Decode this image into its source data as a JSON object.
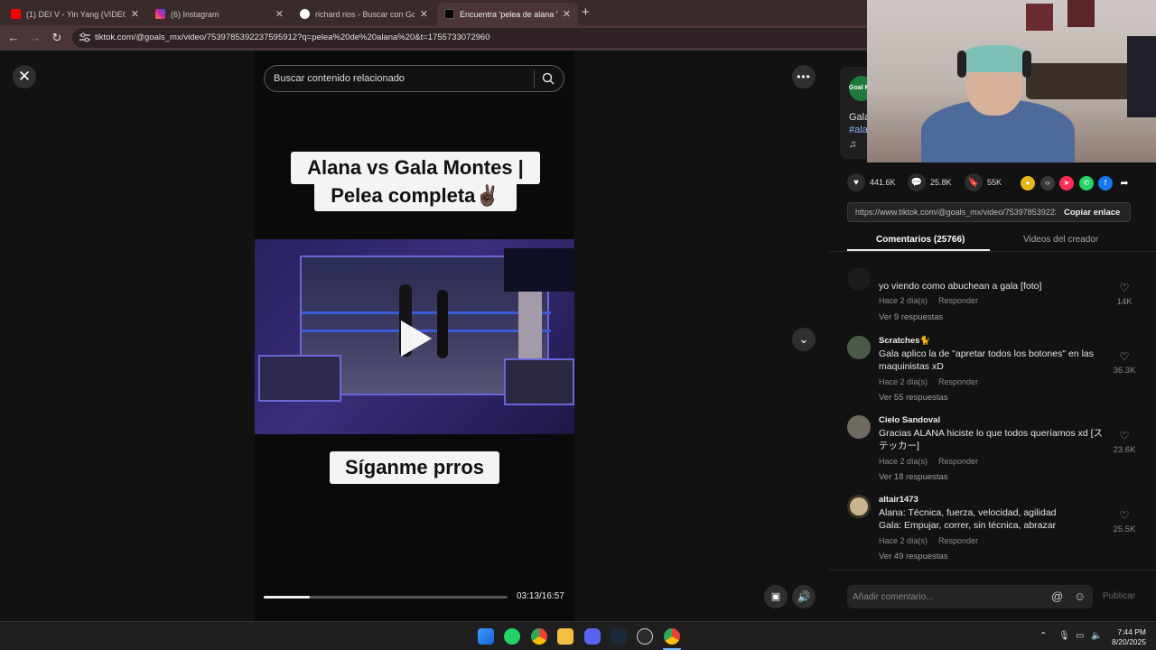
{
  "browser": {
    "tabs": [
      {
        "title": "(1) DEI V - Yin Yang (VIDEO OFICIAL)",
        "favicon_color": "#ff0000",
        "active": false
      },
      {
        "title": "(6) Instagram",
        "favicon_color": "#d6249f",
        "active": false
      },
      {
        "title": "richard rios - Buscar con Google",
        "favicon_color": "#ffffff",
        "active": false
      },
      {
        "title": "Encuentra 'pelea de alana ' en TikTok",
        "favicon_color": "#000000",
        "active": true
      }
    ],
    "new_tab": "+",
    "close_glyph": "✕",
    "url": "tiktok.com/@goals_mx/video/7539785392237595912?q=pelea%20de%20alana%20&t=1755733072960"
  },
  "video": {
    "search_placeholder": "Buscar contenido relacionado",
    "caption_line1": "Alana vs Gala Montes |",
    "caption_line2": "Pelea completa✌🏿",
    "caption_bottom": "Síganme prros",
    "time": "03:13/16:57",
    "progress": 0.19
  },
  "panel": {
    "creator_avatar_text": "Goal MX",
    "desc_snippet": "Gala",
    "hashtag_snippet": "#ala",
    "stats": {
      "likes": "441.6K",
      "comments": "25.8K",
      "saves": "55K"
    },
    "link": "https://www.tiktok.com/@goals_mx/video/7539785392237595912",
    "copy_label": "Copiar enlace",
    "tabs": {
      "comments": "Comentarios (25766)",
      "creator_videos": "Videos del creador"
    },
    "comments": [
      {
        "user": "",
        "text": "yo viendo como abuchean a gala [foto]",
        "time": "Hace 2 día(s)",
        "reply": "Responder",
        "replies": "Ver 9 respuestas",
        "likes": "14K"
      },
      {
        "user": "Scratches🐈",
        "text": "Gala aplico la de \"apretar todos los botones\" en las maquinistas xD",
        "time": "Hace 2 día(s)",
        "reply": "Responder",
        "replies": "Ver 55 respuestas",
        "likes": "36.3K"
      },
      {
        "user": "Cielo Sandoval",
        "text": "Gracias ALANA hiciste lo que todos queríamos xd [ステッカー]",
        "time": "Hace 2 día(s)",
        "reply": "Responder",
        "replies": "Ver 18 respuestas",
        "likes": "23.6K"
      },
      {
        "user": "altair1473",
        "text": "Alana: Técnica, fuerza, velocidad, agilidad\nGala: Empujar, correr, sin técnica, abrazar",
        "time": "Hace 2 día(s)",
        "reply": "Responder",
        "replies": "Ver 49 respuestas",
        "likes": "25.5K"
      }
    ],
    "comment_placeholder": "Añadir comentario...",
    "publish_label": "Publicar"
  },
  "taskbar": {
    "time": "7:44 PM",
    "date": "8/20/2025"
  },
  "colors": {
    "tab_bar": "#3a2a2c",
    "page_bg": "#121212",
    "accent": "#fe2c55"
  }
}
